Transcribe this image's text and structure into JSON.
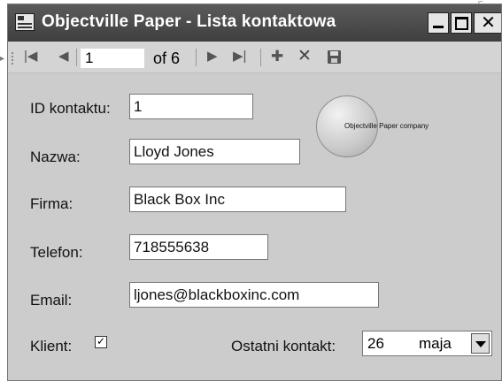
{
  "window": {
    "title": "Objectville Paper - Lista kontaktowa",
    "minimize_icon": "minimize-icon",
    "maximize_icon": "maximize-icon",
    "close_glyph": "✕"
  },
  "navigator": {
    "first_glyph": "|◀",
    "prev_glyph": "◀",
    "position": "1",
    "of_label": "of 6",
    "next_glyph": "▶",
    "last_glyph": "▶|",
    "add_glyph": "✚",
    "delete_glyph": "✕",
    "save_icon": "save-icon"
  },
  "form": {
    "id": {
      "label": "ID kontaktu:",
      "value": "1"
    },
    "name": {
      "label": "Nazwa:",
      "value": "Lloyd Jones"
    },
    "company": {
      "label": "Firma:",
      "value": "Black Box Inc"
    },
    "phone": {
      "label": "Telefon:",
      "value": "718555638"
    },
    "email": {
      "label": "Email:",
      "value": "ljones@blackboxinc.com"
    },
    "client": {
      "label": "Klient:",
      "checked": true,
      "check_glyph": "✓"
    },
    "last_contact": {
      "label": "Ostatni kontakt:",
      "day": "26",
      "month": "maja"
    }
  },
  "logo": {
    "text": "Objectville Paper company"
  }
}
